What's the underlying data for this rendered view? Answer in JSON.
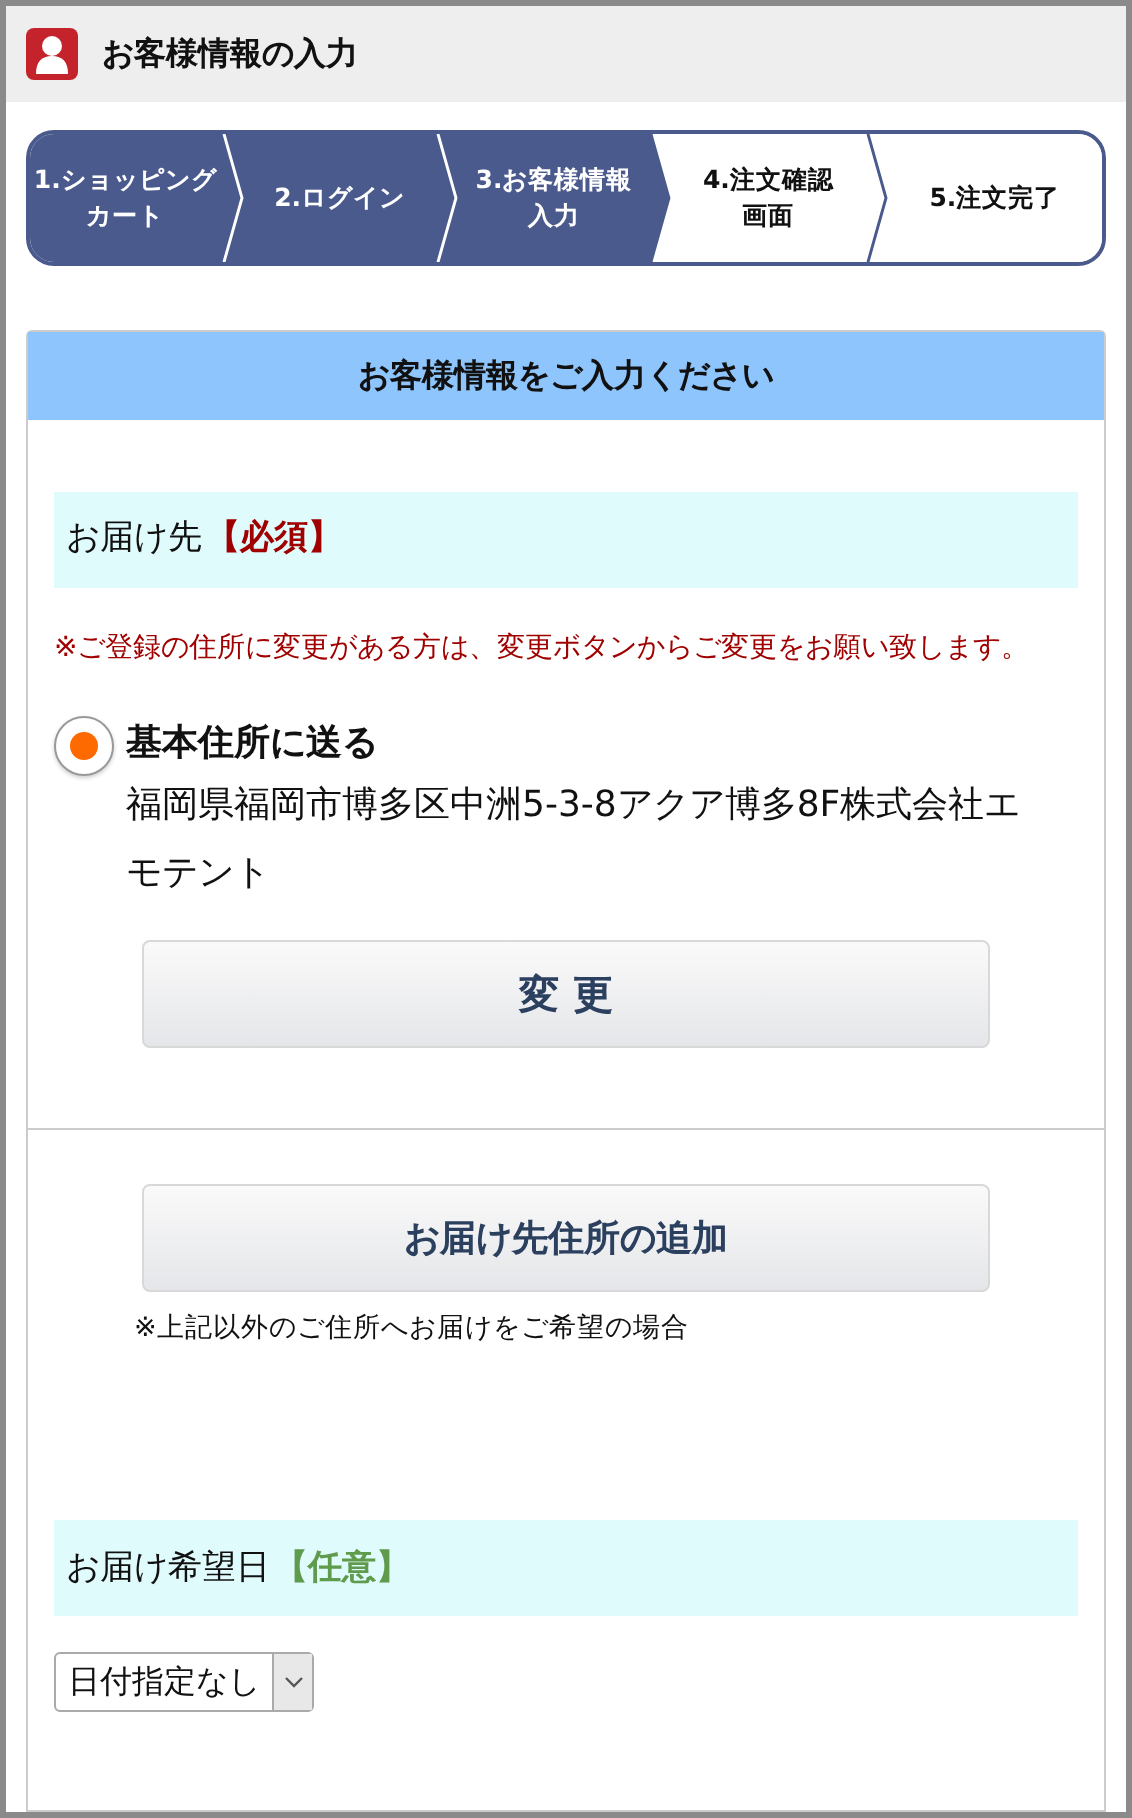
{
  "header": {
    "title": "お客様情報の入力"
  },
  "steps": [
    {
      "lines": [
        "1.ショッピング",
        "カート"
      ],
      "completed": true
    },
    {
      "lines": [
        "2.ログイン"
      ],
      "completed": true
    },
    {
      "lines": [
        "3.お客様情報",
        "入力"
      ],
      "completed": true
    },
    {
      "lines": [
        "4.注文確認",
        "画面"
      ],
      "completed": false
    },
    {
      "lines": [
        "5.注文完了"
      ],
      "completed": false
    }
  ],
  "form": {
    "title": "お客様情報をご入力ください",
    "delivery": {
      "label": "お届け先",
      "tag": "【必須】",
      "kind": "required",
      "note": "※ご登録の住所に変更がある方は、変更ボタンからご変更をお願い致します。",
      "options": [
        {
          "label": "基本住所に送る",
          "address": "福岡県福岡市博多区中洲5-3-8アクア博多8F株式会社エモテント",
          "selected": true
        }
      ],
      "change_button": "変 更"
    },
    "add_address": {
      "button": "お届け先住所の追加",
      "note": "※上記以外のご住所へお届けをご希望の場合"
    },
    "date": {
      "label": "お届け希望日",
      "tag": "【任意】",
      "kind": "optional",
      "select_value": "日付指定なし"
    }
  }
}
